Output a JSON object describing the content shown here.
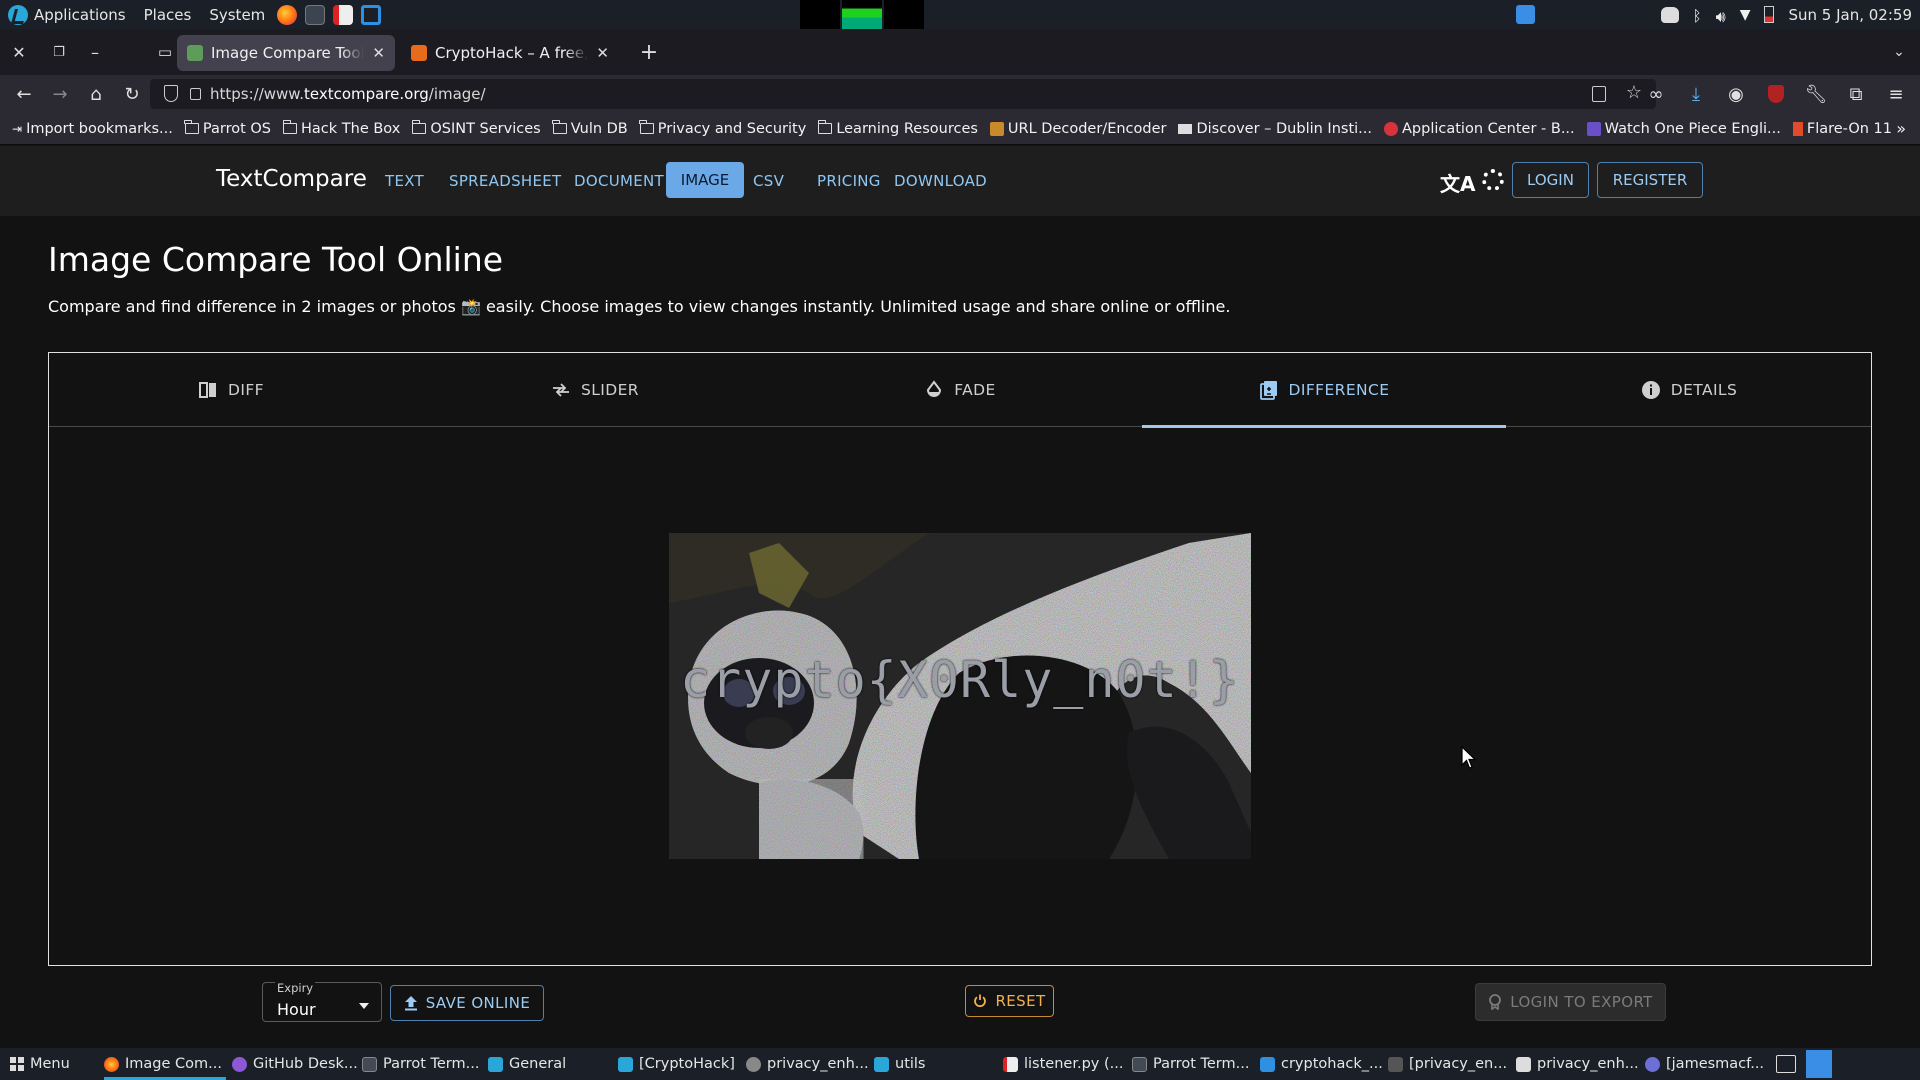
{
  "os": {
    "menu": [
      "Applications",
      "Places",
      "System"
    ],
    "clock": "Sun 5 Jan, 02:59"
  },
  "browser": {
    "tabs": [
      {
        "title": "Image Compare Tool Onli",
        "active": true
      },
      {
        "title": "CryptoHack – A free, fun p",
        "active": false
      }
    ],
    "url": {
      "prefix": "https://www.",
      "host": "textcompare.org",
      "path": "/image/"
    },
    "bookmarks": [
      "Import bookmarks...",
      "Parrot OS",
      "Hack The Box",
      "OSINT Services",
      "Vuln DB",
      "Privacy and Security",
      "Learning Resources",
      "URL Decoder/Encoder",
      "Discover – Dublin Insti...",
      "Application Center - B...",
      "Watch One Piece Engli...",
      "Flare-On 11"
    ]
  },
  "site": {
    "brand": "TextCompare",
    "nav": [
      "TEXT",
      "SPREADSHEET",
      "DOCUMENT",
      "IMAGE",
      "CSV",
      "PRICING",
      "DOWNLOAD"
    ],
    "login": "LOGIN",
    "register": "REGISTER"
  },
  "page": {
    "title": "Image Compare Tool Online",
    "description": "Compare and find difference in 2 images or photos 📸 easily. Choose images to view changes instantly. Unlimited usage and share online or offline.",
    "tabs": [
      "DIFF",
      "SLIDER",
      "FADE",
      "DIFFERENCE",
      "DETAILS"
    ],
    "active_tab": "DIFFERENCE",
    "image_text": "crypto{X0Rly_n0t!}",
    "expiry_label": "Expiry",
    "expiry_value": "Hour",
    "save_online": "SAVE ONLINE",
    "reset": "RESET",
    "login_to_export": "LOGIN TO EXPORT"
  },
  "taskbar": {
    "menu": "Menu",
    "items": [
      "Image Com...",
      "GitHub Desk...",
      "Parrot Term...",
      "General",
      "[CryptoHack]",
      "privacy_enh...",
      "utils",
      "listener.py (...",
      "Parrot Term...",
      "cryptohack_...",
      "[privacy_en...",
      "privacy_enh...",
      "[jamesmacf..."
    ]
  },
  "colors": {
    "accent": "#6aa8e8",
    "link": "#8fc7f2",
    "reset": "#f3b04c",
    "parrot": "#2aa7d9"
  }
}
